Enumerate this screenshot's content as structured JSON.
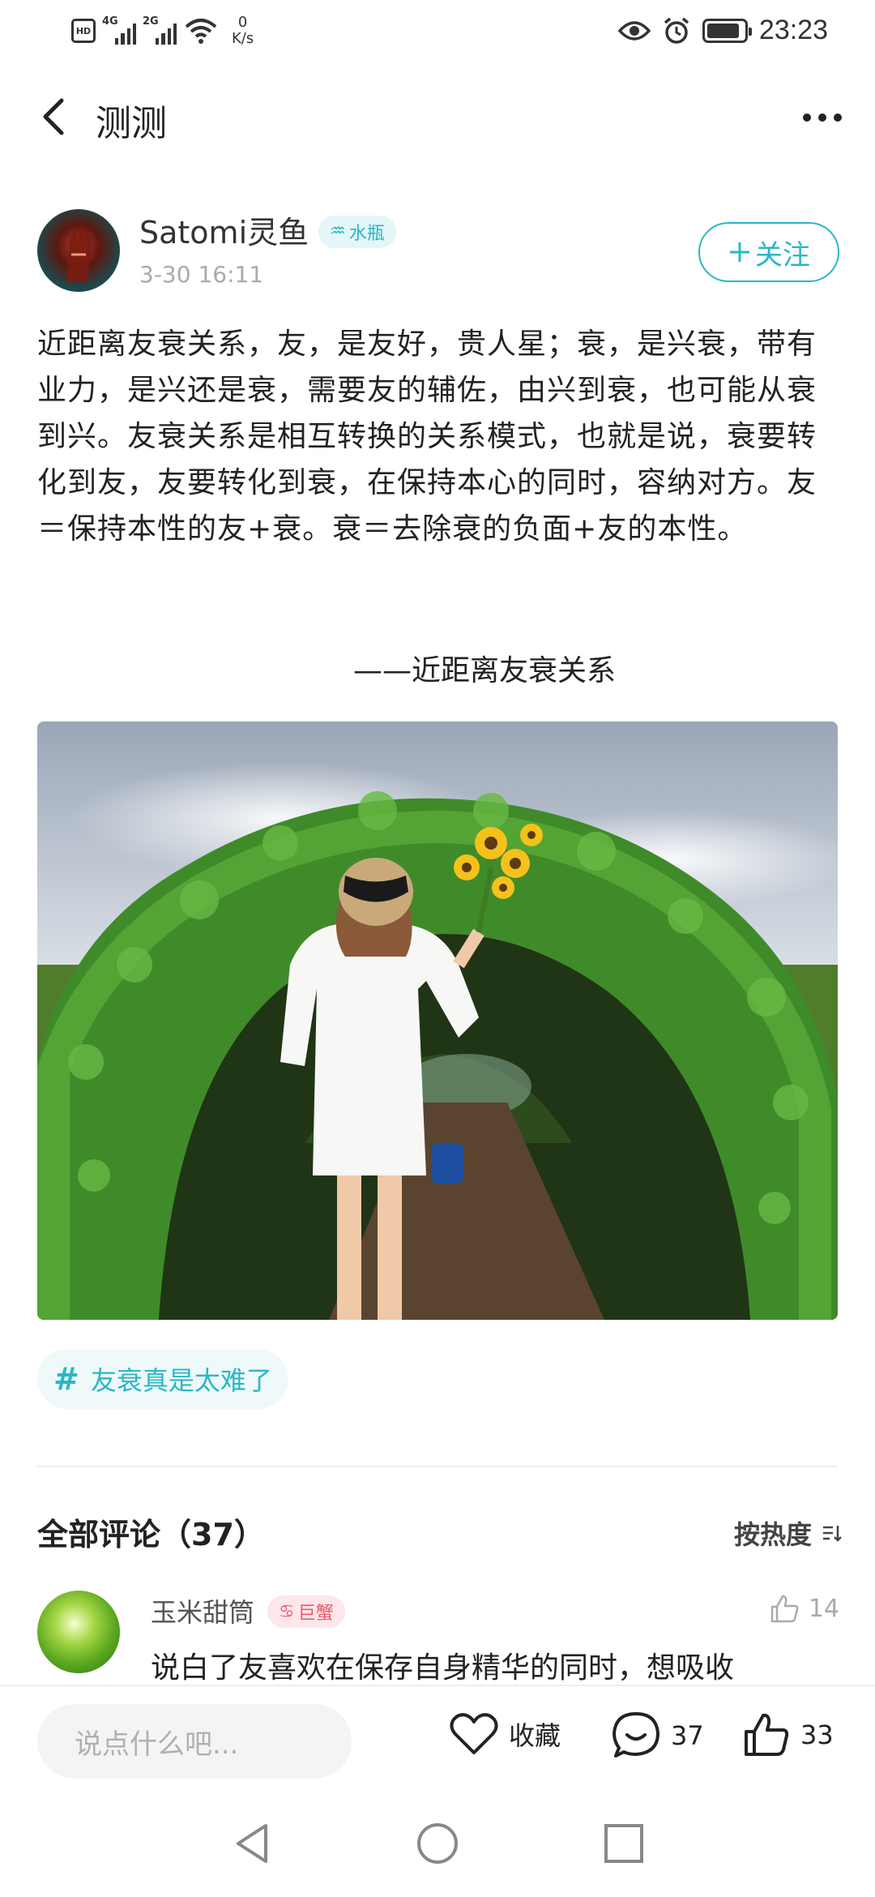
{
  "status_bar": {
    "hd_label": "HD",
    "net1_label": "4G",
    "net2_label": "2G",
    "speed_value": "0",
    "speed_unit": "K/s",
    "time": "23:23"
  },
  "header": {
    "title": "测测",
    "back_icon": "chevron-left-icon",
    "more_icon": "more-dots-icon"
  },
  "author": {
    "name": "Satomi灵鱼",
    "zodiac_symbol": "♒",
    "zodiac_label": "水瓶",
    "date": "3-30 16:11",
    "follow_label": "关注",
    "follow_icon": "plus-icon"
  },
  "post": {
    "text": "近距离友衰关系，友，是友好，贵人星；衰，是兴衰，带有业力，是兴还是衰，需要友的辅佐，由兴到衰，也可能从衰到兴。友衰关系是相互转换的关系模式，也就是说，衰要转化到友，友要转化到衰，在保持本心的同时，容纳对方。友＝保持本性的友+衰。衰＝去除衰的负面+友的本性。",
    "quote": "——近距离友衰关系",
    "tag_symbol": "#",
    "tag": "友衰真是太难了"
  },
  "comments": {
    "title": "全部评论（37）",
    "sort_label": "按热度",
    "items": [
      {
        "name": "玉米甜筒",
        "zodiac_symbol": "♋",
        "zodiac_label": "巨蟹",
        "likes": "14",
        "text": "说白了友喜欢在保存自身精华的同时，想吸收"
      }
    ]
  },
  "bottom_bar": {
    "input_placeholder": "说点什么吧...",
    "favorite_label": "收藏",
    "comment_count": "37",
    "like_count": "33"
  },
  "colors": {
    "accent": "#2bb7c7",
    "zodiac_badge_bg": "#e3f6f8",
    "crab_badge_bg": "#fde7ea",
    "crab_badge_text": "#e85b70"
  }
}
